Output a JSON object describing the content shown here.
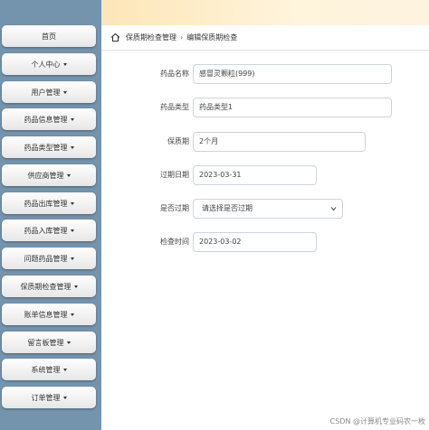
{
  "sidebar": {
    "items": [
      {
        "label": "首页",
        "has_caret": false
      },
      {
        "label": "个人中心",
        "has_caret": true
      },
      {
        "label": "用户管理",
        "has_caret": true
      },
      {
        "label": "药品信息管理",
        "has_caret": true
      },
      {
        "label": "药品类型管理",
        "has_caret": true
      },
      {
        "label": "供应商管理",
        "has_caret": true
      },
      {
        "label": "药品出库管理",
        "has_caret": true
      },
      {
        "label": "药品入库管理",
        "has_caret": true
      },
      {
        "label": "问题药品管理",
        "has_caret": true
      },
      {
        "label": "保质期检查管理",
        "has_caret": true
      },
      {
        "label": "账单信息管理",
        "has_caret": true
      },
      {
        "label": "留言板管理",
        "has_caret": true
      },
      {
        "label": "系统管理",
        "has_caret": true
      },
      {
        "label": "订单管理",
        "has_caret": true
      }
    ]
  },
  "breadcrumb": {
    "icon": "home-icon",
    "parent": "保质期检查管理",
    "separator": "›",
    "current": "编辑保质期检查"
  },
  "form": {
    "fields": [
      {
        "label": "药品名称",
        "value": "感冒灵颗粒(999)",
        "type": "text"
      },
      {
        "label": "药品类型",
        "value": "药品类型1",
        "type": "text"
      },
      {
        "label": "保质期",
        "value": "2个月",
        "type": "text"
      },
      {
        "label": "过期日期",
        "value": "2023-03-31",
        "type": "date"
      },
      {
        "label": "是否过期",
        "value": "请选择是否过期",
        "type": "select"
      },
      {
        "label": "检查时间",
        "value": "2023-03-02",
        "type": "date"
      }
    ]
  },
  "watermark": "CSDN @计算机专业码农一枚",
  "colors": {
    "sidebar": "#7493ac",
    "topbar": "#fde6b8",
    "input_border": "#cfd4da"
  }
}
